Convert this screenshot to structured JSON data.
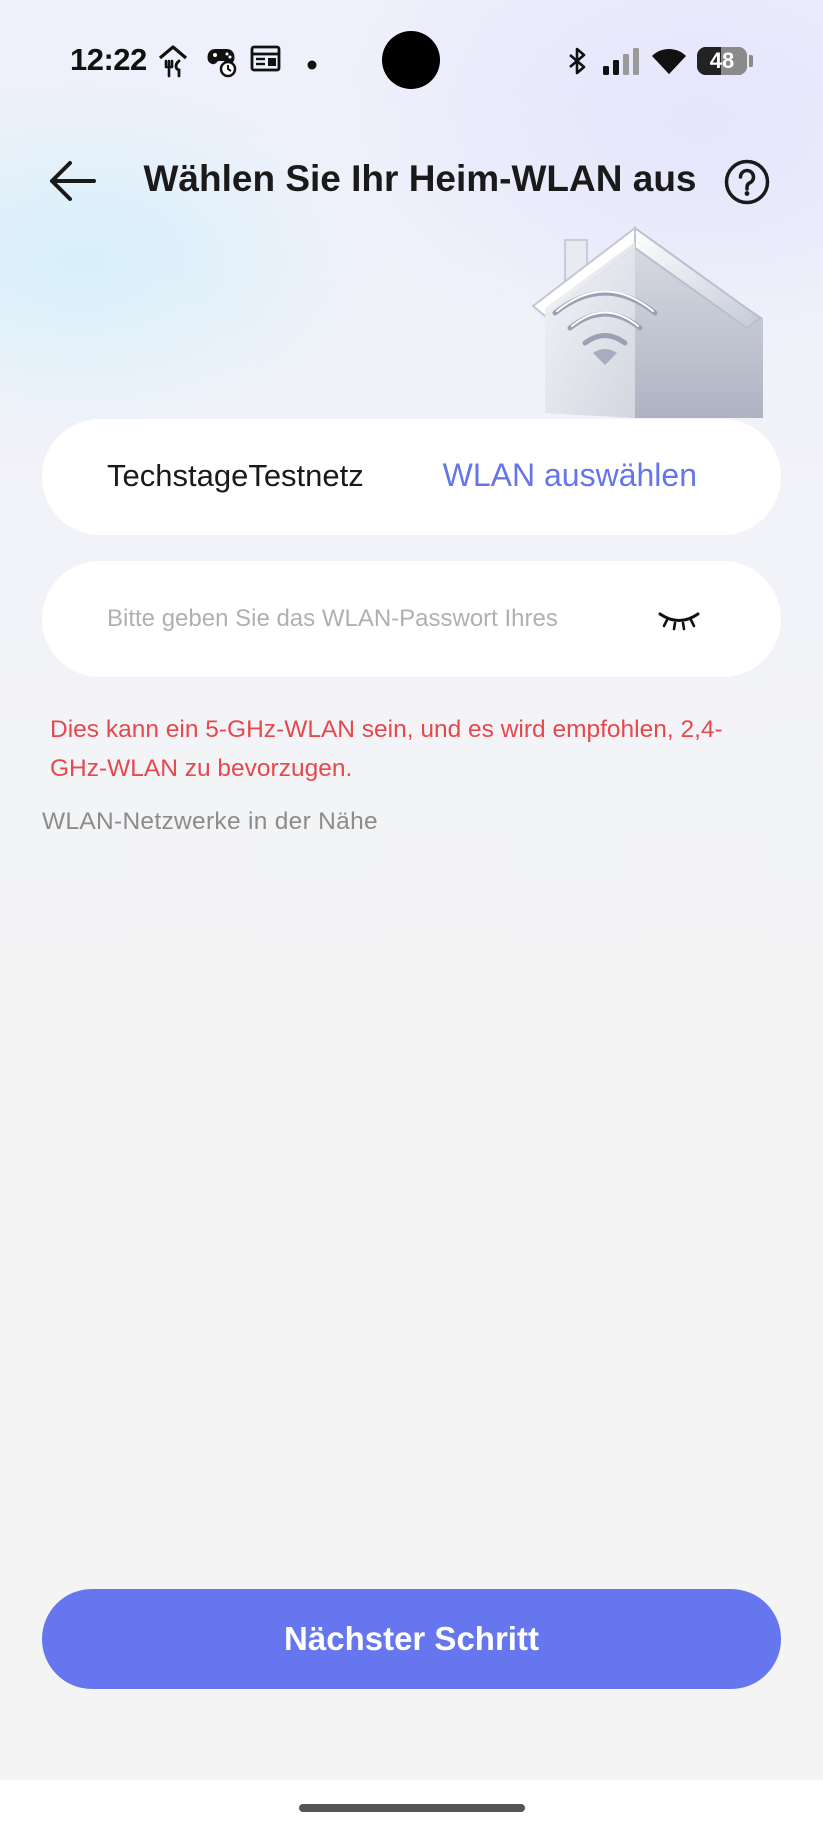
{
  "status_bar": {
    "time": "12:22",
    "battery_level": "48",
    "battery_fraction": 0.48,
    "icons": [
      "food-delivery-icon",
      "gamepad-alarm-icon",
      "news-icon",
      "notification-dot-icon",
      "bluetooth-icon",
      "signal-icon",
      "wifi-icon",
      "battery-icon"
    ]
  },
  "header": {
    "title": "Wählen Sie Ihr Heim-WLAN aus",
    "back_icon": "arrow-left-icon",
    "help_icon": "question-circle-icon"
  },
  "illustration": "house-wifi-icon",
  "wifi_selection": {
    "ssid": "TechstageTestnetz",
    "select_label": "WLAN auswählen"
  },
  "password": {
    "value": "",
    "placeholder": "Bitte geben Sie das WLAN-Passwort Ihres",
    "toggle_icon": "eye-closed-icon"
  },
  "warning": "Dies kann ein 5-GHz-WLAN sein, und es wird empfohlen, 2,4-GHz-WLAN zu bevorzugen.",
  "nearby_label": "WLAN-Netzwerke in der Nähe",
  "next_button": "Nächster Schritt",
  "colors": {
    "accent": "#6576ef",
    "link": "#6676e8",
    "warning": "#e5484d",
    "background": "#f4f4f5"
  }
}
